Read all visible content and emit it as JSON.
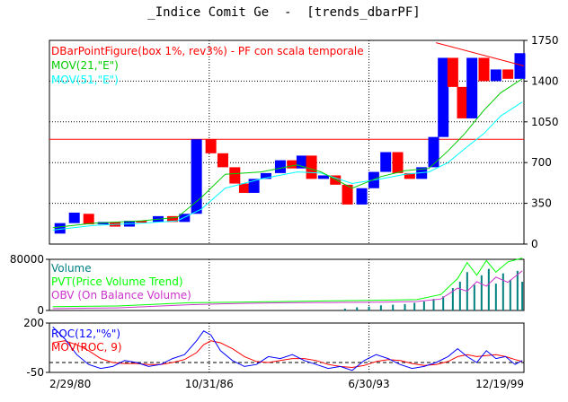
{
  "window": {
    "title": "_Indice Comit Ge  -  [trends_dbarPF]"
  },
  "colors": {
    "up_box": "#0000ff",
    "down_box": "#ff0000",
    "mov_fast": "#00cc00",
    "mov_slow": "#00ffff",
    "volume": "#008080",
    "pvt": "#00ff00",
    "obv": "#cc33cc",
    "roc": "#0000ff",
    "roc_mov": "#ff0000",
    "hline": "#ff0000",
    "trendline": "#ff0000"
  },
  "chart_data": [
    {
      "type": "candlestick",
      "panel": "price",
      "legend": [
        {
          "label": "DBarPointFigure(box 1%, rev3%) - PF con scala temporale",
          "color": "#ff0000"
        },
        {
          "label": "MOV(21,\"E\")",
          "color": "#00cc00"
        },
        {
          "label": "MOV(51,\"E\")",
          "color": "#00ffff"
        }
      ],
      "y_ticks": [
        0,
        350,
        700,
        1050,
        1400,
        1750
      ],
      "ylim": [
        0,
        1750
      ],
      "x_ticks": [
        "2/29/80",
        "10/31/86",
        "6/30/93",
        "12/19/99"
      ],
      "xlim": [
        1980.16,
        1999.97
      ],
      "horizontal_line": 900,
      "trendline": {
        "x": [
          1996.3,
          1999.97
        ],
        "y": [
          1730,
          1530
        ]
      },
      "bars": [
        {
          "x": 1980.6,
          "o": 90,
          "c": 180
        },
        {
          "x": 1981.2,
          "o": 180,
          "c": 270
        },
        {
          "x": 1981.8,
          "o": 260,
          "c": 170
        },
        {
          "x": 1982.4,
          "o": 170,
          "c": 190
        },
        {
          "x": 1982.9,
          "o": 190,
          "c": 150
        },
        {
          "x": 1983.5,
          "o": 150,
          "c": 200
        },
        {
          "x": 1984.0,
          "o": 200,
          "c": 190
        },
        {
          "x": 1984.7,
          "o": 190,
          "c": 240
        },
        {
          "x": 1985.3,
          "o": 240,
          "c": 190
        },
        {
          "x": 1985.8,
          "o": 190,
          "c": 260
        },
        {
          "x": 1986.3,
          "o": 260,
          "c": 900
        },
        {
          "x": 1986.9,
          "o": 900,
          "c": 780
        },
        {
          "x": 1987.4,
          "o": 780,
          "c": 660
        },
        {
          "x": 1987.9,
          "o": 660,
          "c": 520
        },
        {
          "x": 1988.3,
          "o": 520,
          "c": 440
        },
        {
          "x": 1988.7,
          "o": 440,
          "c": 560
        },
        {
          "x": 1989.2,
          "o": 560,
          "c": 610
        },
        {
          "x": 1989.8,
          "o": 610,
          "c": 720
        },
        {
          "x": 1990.3,
          "o": 720,
          "c": 650
        },
        {
          "x": 1990.7,
          "o": 650,
          "c": 760
        },
        {
          "x": 1991.1,
          "o": 760,
          "c": 560
        },
        {
          "x": 1991.6,
          "o": 560,
          "c": 590
        },
        {
          "x": 1992.1,
          "o": 590,
          "c": 510
        },
        {
          "x": 1992.6,
          "o": 510,
          "c": 340
        },
        {
          "x": 1993.2,
          "o": 340,
          "c": 480
        },
        {
          "x": 1993.7,
          "o": 480,
          "c": 620
        },
        {
          "x": 1994.2,
          "o": 620,
          "c": 790
        },
        {
          "x": 1994.7,
          "o": 790,
          "c": 610
        },
        {
          "x": 1995.2,
          "o": 610,
          "c": 560
        },
        {
          "x": 1995.7,
          "o": 560,
          "c": 660
        },
        {
          "x": 1996.2,
          "o": 660,
          "c": 920
        },
        {
          "x": 1996.6,
          "o": 920,
          "c": 1600
        },
        {
          "x": 1997.0,
          "o": 1600,
          "c": 1350
        },
        {
          "x": 1997.4,
          "o": 1350,
          "c": 1080
        },
        {
          "x": 1997.8,
          "o": 1080,
          "c": 1600
        },
        {
          "x": 1998.3,
          "o": 1600,
          "c": 1400
        },
        {
          "x": 1998.8,
          "o": 1400,
          "c": 1500
        },
        {
          "x": 1999.3,
          "o": 1500,
          "c": 1420
        },
        {
          "x": 1999.8,
          "o": 1420,
          "c": 1640
        }
      ],
      "series": [
        {
          "name": "MOV(21,\"E\")",
          "x": [
            1980.3,
            1982,
            1984,
            1985.5,
            1986.5,
            1987.5,
            1989,
            1990.5,
            1991.5,
            1992.8,
            1994,
            1995,
            1996,
            1996.8,
            1997.5,
            1998.3,
            1999.0,
            1999.9
          ],
          "y": [
            140,
            180,
            200,
            230,
            400,
            600,
            620,
            680,
            620,
            480,
            580,
            630,
            650,
            800,
            950,
            1150,
            1300,
            1420
          ]
        },
        {
          "name": "MOV(51,\"E\")",
          "x": [
            1980.3,
            1982,
            1984,
            1985.5,
            1986.5,
            1987.5,
            1989,
            1990.5,
            1991.5,
            1992.8,
            1994,
            1995,
            1996,
            1996.8,
            1997.5,
            1998.3,
            1999.0,
            1999.9
          ],
          "y": [
            120,
            160,
            180,
            200,
            300,
            480,
            560,
            620,
            610,
            520,
            560,
            600,
            620,
            700,
            820,
            950,
            1100,
            1220
          ]
        }
      ]
    },
    {
      "type": "bar",
      "panel": "volume",
      "legend": [
        {
          "label": "Volume",
          "color": "#008080"
        },
        {
          "label": "PVT(Price Volume Trend)",
          "color": "#00ff00"
        },
        {
          "label": "OBV (On Balance Volume)",
          "color": "#cc33cc"
        }
      ],
      "y_ticks": [
        0,
        80000
      ],
      "ylim": [
        0,
        80000
      ],
      "series": [
        {
          "name": "PVT(Price Volume Trend)",
          "x": [
            1980.3,
            1983,
            1986,
            1988,
            1990,
            1992,
            1994,
            1995.5,
            1996.5,
            1997.2,
            1997.6,
            1998.0,
            1998.4,
            1998.8,
            1999.3,
            1999.9
          ],
          "y": [
            6000,
            7000,
            12000,
            13000,
            14000,
            15000,
            16000,
            17000,
            25000,
            50000,
            75000,
            55000,
            78000,
            60000,
            76000,
            82000
          ]
        },
        {
          "name": "OBV (On Balance Volume)",
          "x": [
            1980.3,
            1983,
            1986,
            1988,
            1990,
            1992,
            1994,
            1995.5,
            1996.5,
            1997.2,
            1997.6,
            1998.0,
            1998.4,
            1998.8,
            1999.3,
            1999.9
          ],
          "y": [
            3000,
            4000,
            9000,
            11000,
            12000,
            12500,
            13000,
            14000,
            18000,
            35000,
            30000,
            45000,
            38000,
            52000,
            44000,
            62000
          ]
        }
      ],
      "volume_bars": [
        {
          "x": 1992.5,
          "v": 3000
        },
        {
          "x": 1993.0,
          "v": 5000
        },
        {
          "x": 1993.5,
          "v": 6000
        },
        {
          "x": 1994.0,
          "v": 8000
        },
        {
          "x": 1994.5,
          "v": 9000
        },
        {
          "x": 1995.0,
          "v": 10000
        },
        {
          "x": 1995.4,
          "v": 12000
        },
        {
          "x": 1995.8,
          "v": 14000
        },
        {
          "x": 1996.2,
          "v": 18000
        },
        {
          "x": 1996.6,
          "v": 22000
        },
        {
          "x": 1997.0,
          "v": 35000
        },
        {
          "x": 1997.3,
          "v": 45000
        },
        {
          "x": 1997.6,
          "v": 60000
        },
        {
          "x": 1997.9,
          "v": 40000
        },
        {
          "x": 1998.2,
          "v": 55000
        },
        {
          "x": 1998.5,
          "v": 65000
        },
        {
          "x": 1998.8,
          "v": 42000
        },
        {
          "x": 1999.1,
          "v": 58000
        },
        {
          "x": 1999.4,
          "v": 48000
        },
        {
          "x": 1999.7,
          "v": 62000
        },
        {
          "x": 1999.9,
          "v": 45000
        }
      ]
    },
    {
      "type": "line",
      "panel": "roc",
      "legend": [
        {
          "label": "ROC(12,\"%\")",
          "color": "#0000ff"
        },
        {
          "label": "MOV(ROC, 9)",
          "color": "#ff0000"
        }
      ],
      "y_ticks": [
        -50,
        200
      ],
      "ylim": [
        -50,
        200
      ],
      "zero_line": 0,
      "series": [
        {
          "name": "ROC(12,\"%\")",
          "x": [
            1980.3,
            1980.8,
            1981.3,
            1981.8,
            1982.3,
            1982.8,
            1983.3,
            1983.8,
            1984.3,
            1984.8,
            1985.3,
            1985.8,
            1986.3,
            1986.6,
            1986.9,
            1987.3,
            1987.8,
            1988.3,
            1988.8,
            1989.3,
            1989.8,
            1990.3,
            1990.8,
            1991.3,
            1991.8,
            1992.3,
            1992.8,
            1993.3,
            1993.8,
            1994.3,
            1994.8,
            1995.3,
            1995.8,
            1996.3,
            1996.8,
            1997.2,
            1997.6,
            1998.0,
            1998.4,
            1998.8,
            1999.2,
            1999.6,
            1999.9
          ],
          "y": [
            180,
            120,
            40,
            -10,
            -30,
            -20,
            10,
            0,
            -20,
            -10,
            20,
            40,
            110,
            160,
            140,
            60,
            10,
            -20,
            -10,
            30,
            20,
            40,
            10,
            -10,
            -30,
            -20,
            -40,
            10,
            40,
            20,
            -10,
            -30,
            -20,
            0,
            30,
            70,
            30,
            0,
            60,
            20,
            30,
            -10,
            10
          ]
        },
        {
          "name": "MOV(ROC, 9)",
          "x": [
            1980.3,
            1980.8,
            1981.3,
            1981.8,
            1982.3,
            1982.8,
            1983.3,
            1983.8,
            1984.3,
            1984.8,
            1985.3,
            1985.8,
            1986.3,
            1986.6,
            1986.9,
            1987.3,
            1987.8,
            1988.3,
            1988.8,
            1989.3,
            1989.8,
            1990.3,
            1990.8,
            1991.3,
            1991.8,
            1992.3,
            1992.8,
            1993.3,
            1993.8,
            1994.3,
            1994.8,
            1995.3,
            1995.8,
            1996.3,
            1996.8,
            1997.2,
            1997.6,
            1998.0,
            1998.4,
            1998.8,
            1999.2,
            1999.6,
            1999.9
          ],
          "y": [
            100,
            110,
            90,
            60,
            20,
            0,
            -5,
            -5,
            -10,
            -10,
            0,
            15,
            50,
            90,
            110,
            100,
            70,
            30,
            5,
            0,
            10,
            20,
            20,
            10,
            -10,
            -20,
            -25,
            -15,
            5,
            15,
            10,
            -5,
            -15,
            -10,
            5,
            30,
            40,
            30,
            35,
            40,
            30,
            15,
            5
          ]
        }
      ]
    }
  ]
}
